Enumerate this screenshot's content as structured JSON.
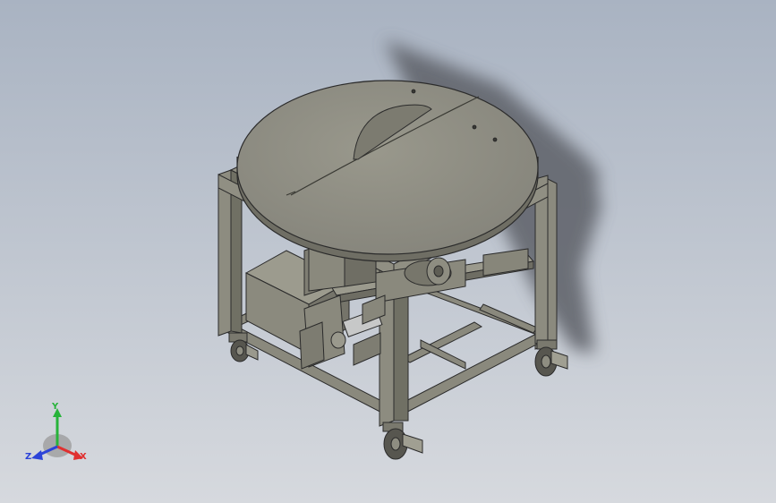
{
  "viewport": {
    "background_top": "#a9b3c2",
    "background_bottom": "#d6d9de"
  },
  "model": {
    "part_color": "#8d8c80",
    "part_dark": "#6f6e64",
    "part_light": "#a5a497",
    "edge_color": "#2b2b2b"
  },
  "triad": {
    "x_label": "X",
    "y_label": "Y",
    "z_label": "Z",
    "x_color": "#e03030",
    "y_color": "#27b33a",
    "z_color": "#2c43d8"
  }
}
